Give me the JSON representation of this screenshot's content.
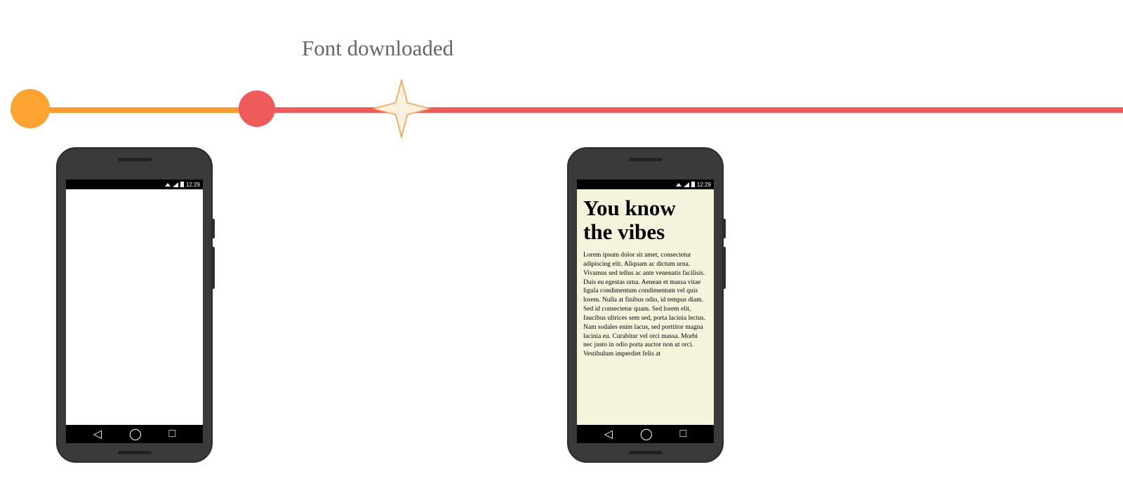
{
  "timeline": {
    "label": "Font downloaded",
    "colors": {
      "segment1": "#fc9a32",
      "segment2": "#ef5a5b",
      "dot1": "#fca332",
      "dot2": "#ef5a5b",
      "star_fill": "#faf2dc",
      "star_stroke": "#f2a35a"
    }
  },
  "phone_status": {
    "time": "12:29"
  },
  "phone_right": {
    "title": "You know the vibes",
    "body": "Lorem ipsum dolor sit amet, consectetur adipiscing elit. Aliquam ac dictum urna. Vivamus sed tellus ac ante venenatis facilisis. Duis eu egestas urna. Aenean et massa vitae ligula condimentum condimentum vel quis lorem. Nulla at finibus odio, id tempus diam. Sed id consectetur quam. Sed lorem elit, faucibus ultrices sem sed, porta lacinia lectus. Nam sodales enim lacus, sed porttitor magna lacinia eu. Curabitur vel orci massa. Morbi nec justo in odio porta auctor non ut orci. Vestibulum imperdiet felis at"
  },
  "nav_icons": {
    "back": "◁",
    "home": "◯",
    "recent": "□"
  }
}
